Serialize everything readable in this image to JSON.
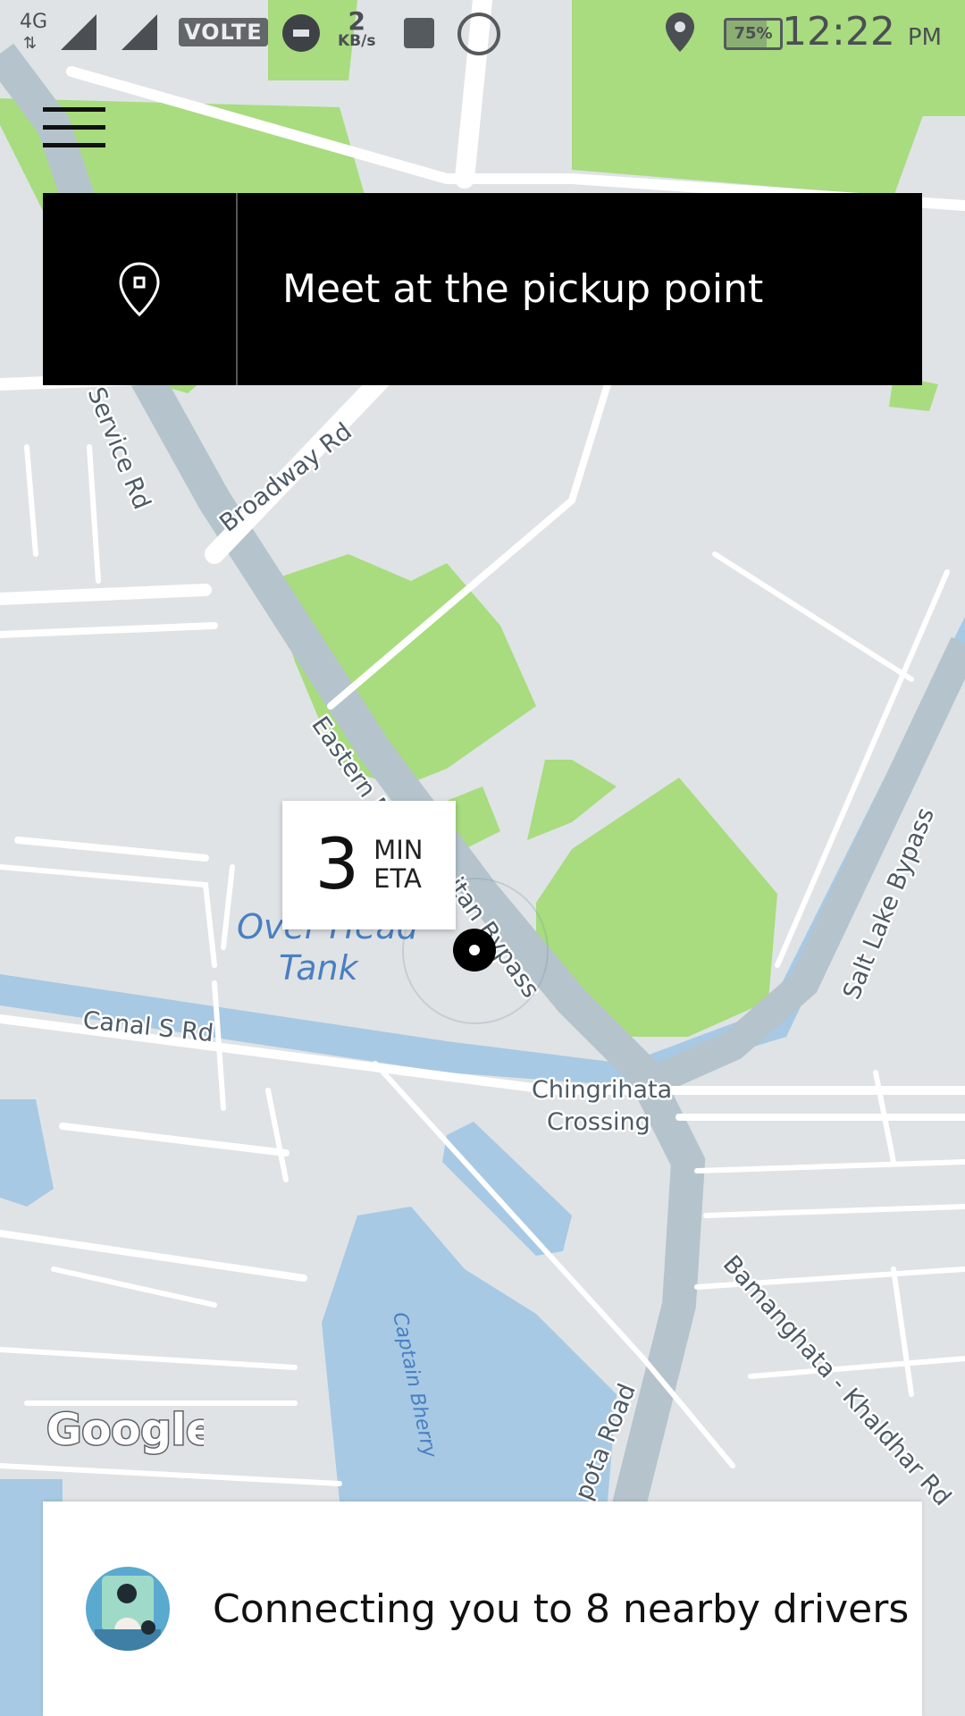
{
  "status_bar": {
    "network": "4G",
    "sim1": "1",
    "sim2": "2",
    "volte": "VOLTE",
    "speed_value": "2",
    "speed_unit": "KB/s",
    "battery_percent": 75,
    "battery_label": "75%",
    "time": "12:22",
    "ampm": "PM",
    "icons": [
      "uber-icon",
      "image-icon",
      "whatsapp-icon",
      "location-icon",
      "battery-icon"
    ]
  },
  "banner": {
    "text": "Meet at the pickup point",
    "icon": "location-pin-icon"
  },
  "eta": {
    "number": "3",
    "unit": "MIN",
    "label": "ETA"
  },
  "map": {
    "attribution": "Google",
    "labels": {
      "service_rd": "Service Rd",
      "broadway_rd": "Broadway Rd",
      "eastern_bypass_a": "Eastern M",
      "eastern_bypass_b": "itan Bypass",
      "overhead_1": "Over Head",
      "overhead_2": "Tank",
      "canal_s_rd": "Canal S Rd",
      "chingrihata_1": "Chingrihata",
      "chingrihata_2": "Crossing",
      "salt_lake_bypass": "Salt Lake Bypass",
      "bamanghata": "Bamanghata - Khaldhar Rd",
      "captain_bherry": "Captain Bherry",
      "road_bottom": "pota Road"
    }
  },
  "bottom_card": {
    "text": "Connecting you to 8 nearby drivers",
    "avatar": "driver-illustration-icon"
  },
  "colors": {
    "map_bg": "#dfe3e6",
    "park": "#a8dc7f",
    "water": "#a7c9e4",
    "highway": "#b5c4cc",
    "banner_bg": "#000000"
  }
}
